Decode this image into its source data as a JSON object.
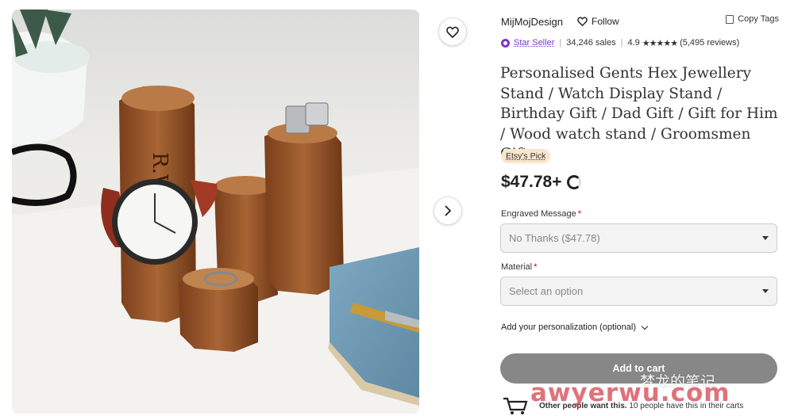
{
  "shop": {
    "name": "MijMojDesign",
    "follow_label": "Follow",
    "copy_tags_label": "Copy Tags"
  },
  "rating": {
    "star_seller_label": "Star Seller",
    "sales": "34,246 sales",
    "score": "4.9",
    "stars": "★★★★★",
    "reviews": "(5,495 reviews)"
  },
  "product": {
    "title": "Personalised Gents Hex Jewellery Stand / Watch Display Stand / Birthday Gift / Dad Gift / Gift for Him / Wood watch stand / Groomsmen Gifts",
    "badge": "Etsy's Pick",
    "price": "$47.78+",
    "photo_text": "R.W."
  },
  "options": {
    "engraved": {
      "label": "Engraved Message",
      "required_mark": "*",
      "value": "No Thanks ($47.78)"
    },
    "material": {
      "label": "Material",
      "required_mark": "*",
      "value": "Select an option"
    }
  },
  "personalization_label": "Add your personalization (optional)",
  "add_to_cart_label": "Add to cart",
  "demand": {
    "bold": "Other people want this.",
    "rest": " 10 people have this in their carts"
  },
  "watermark": {
    "line": "梦龙的笔记",
    "url": "awyerwu.com"
  },
  "colors": {
    "star_seller": "#7a36c8",
    "badge_bg": "#fbe5cc",
    "button_bg": "#878787"
  },
  "icons": [
    "heart-icon",
    "chevron-right-icon",
    "chevron-left-icon",
    "copy-icon",
    "star-seller-badge-icon",
    "caret-down-icon",
    "cart-icon",
    "spinner-icon"
  ]
}
